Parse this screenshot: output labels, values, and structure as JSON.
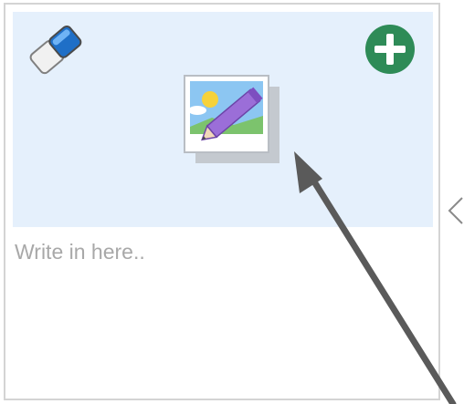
{
  "card": {
    "text_placeholder": "Write in here..",
    "text_value": ""
  },
  "icons": {
    "eraser": "eraser-icon",
    "add": "add-icon",
    "insert_image": "insert-image-icon",
    "next": "chevron-left-icon",
    "annotation_arrow": "annotation-arrow"
  },
  "colors": {
    "image_area_bg": "#e5f0fc",
    "add_button": "#2e8b57",
    "card_border": "#d4d4d4",
    "annotation_arrow": "#5a5a5a"
  }
}
